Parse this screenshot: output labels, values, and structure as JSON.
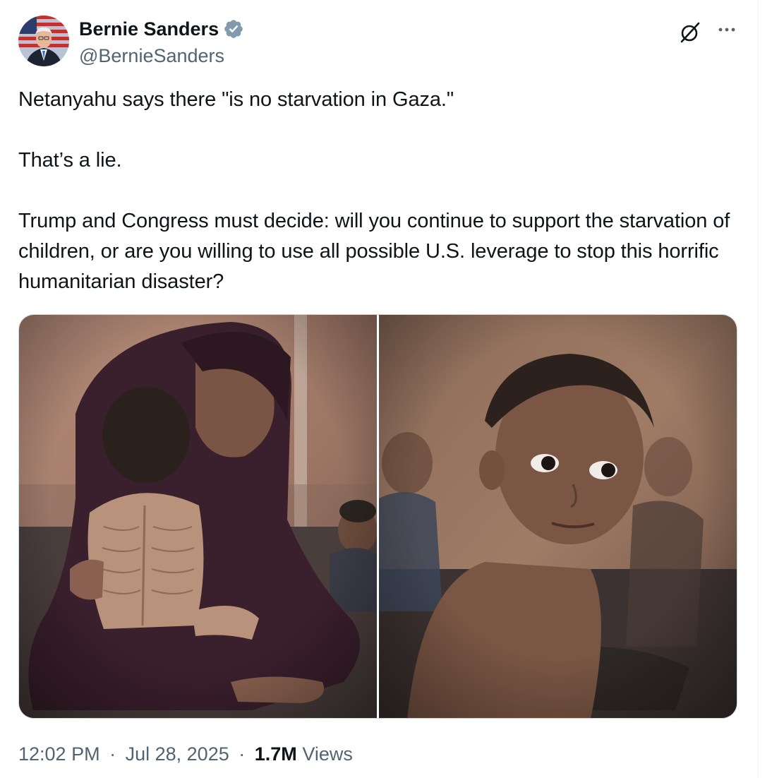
{
  "author": {
    "display_name": "Bernie Sanders",
    "handle": "@BernieSanders",
    "verified": true,
    "verified_badge_color": "#829aab",
    "avatar_icon": "profile-photo-avatar"
  },
  "header_actions": {
    "grok_icon": "grok-icon",
    "more_icon": "more-horizontal-icon"
  },
  "tweet": {
    "paragraphs": [
      "Netanyahu says there \"is no starvation in Gaza.\"",
      "That’s a lie.",
      "Trump and Congress must decide: will you continue to support the starvation of children, or are you willing to use all possible U.S. leverage to stop this horrific humanitarian disaster?"
    ]
  },
  "media": {
    "photos": [
      {
        "icon": "photo-mother-holding-emaciated-child"
      },
      {
        "icon": "photo-emaciated-boy-looking-sideways"
      }
    ]
  },
  "meta": {
    "time": "12:02 PM",
    "separator": "·",
    "date": "Jul 28, 2025",
    "views_count": "1.7M",
    "views_label": "Views"
  },
  "colors": {
    "text_primary": "#0f1419",
    "text_secondary": "#536471",
    "border": "#cfd9de"
  }
}
